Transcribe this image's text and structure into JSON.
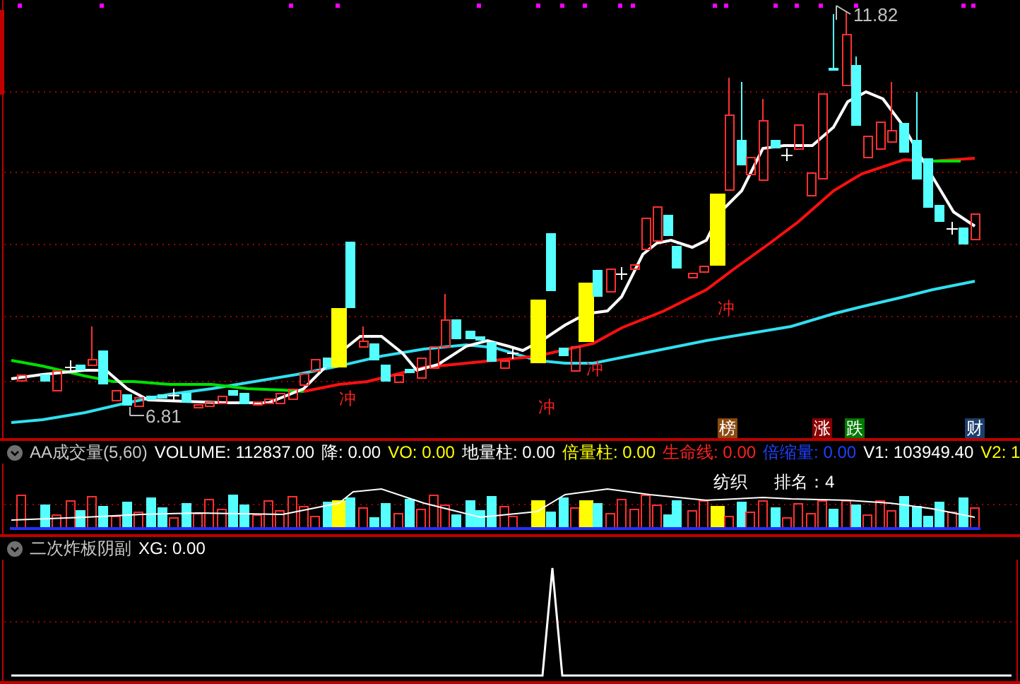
{
  "chart": {
    "high_label": "11.82",
    "low_label": "6.81",
    "signals": [
      {
        "text": "冲"
      },
      {
        "text": "冲"
      },
      {
        "text": "冲"
      },
      {
        "text": "冲"
      }
    ],
    "badges": [
      {
        "text": "榜",
        "color": "#8b4a10"
      },
      {
        "text": "涨",
        "color": "#8b0000"
      },
      {
        "text": "跌",
        "color": "#007a00"
      },
      {
        "text": "财",
        "color": "#1c3f6e"
      }
    ]
  },
  "volume_panel": {
    "title": "AA成交量(5,60)",
    "fields": [
      {
        "text": "VOLUME: 112837.00",
        "color": "#ffffff"
      },
      {
        "text": "降: 0.00",
        "color": "#ffffff"
      },
      {
        "text": "VO: 0.00",
        "color": "#ffff00"
      },
      {
        "text": "地量柱: 0.00",
        "color": "#ffffff"
      },
      {
        "text": "倍量柱: 0.00",
        "color": "#ffff00"
      },
      {
        "text": "生命线: 0.00",
        "color": "#ff2020"
      },
      {
        "text": "倍缩量: 0.00",
        "color": "#2040ff"
      },
      {
        "text": "V1: 103949.40",
        "color": "#ffffff"
      },
      {
        "text": "V2: 1",
        "color": "#ffff00"
      }
    ],
    "sector": "纺织",
    "rank": "排名：4"
  },
  "signal_panel": {
    "title": "二次炸板阴副",
    "fields": [
      {
        "text": "XG: 0.00",
        "color": "#ffffff"
      }
    ]
  }
}
